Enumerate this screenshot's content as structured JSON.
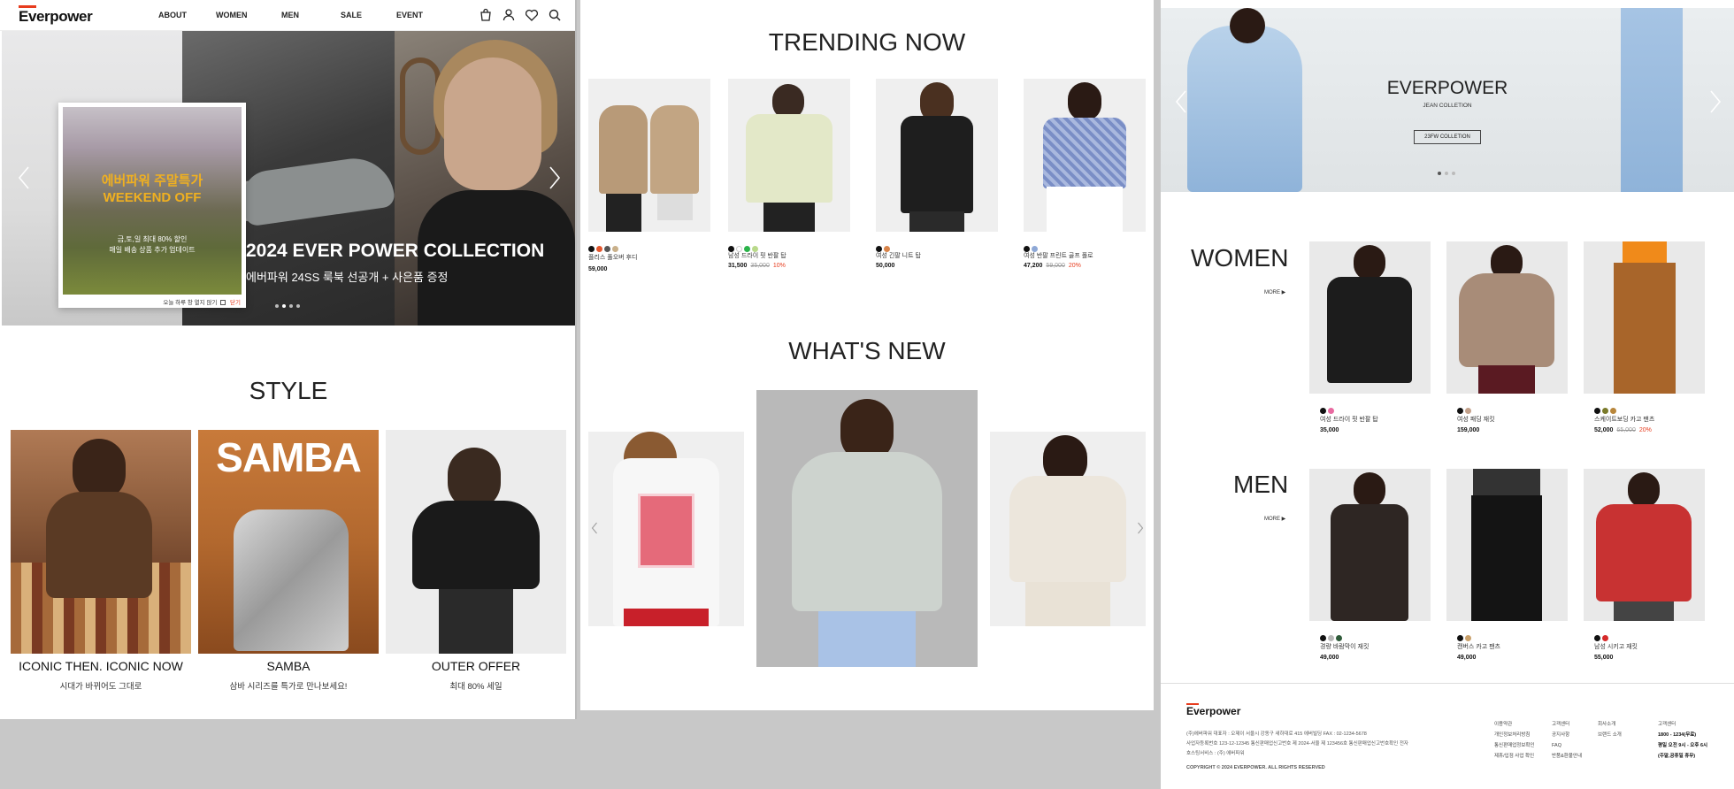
{
  "header": {
    "logo": "Everpower",
    "nav": [
      "ABOUT",
      "WOMEN",
      "MEN",
      "SALE",
      "EVENT"
    ],
    "icons": [
      "bag-icon",
      "user-icon",
      "heart-icon",
      "search-icon"
    ]
  },
  "hero": {
    "popup_title_1": "에버파워 주말특가",
    "popup_title_2": "WEEKEND OFF",
    "popup_sub_1": "금,토,일 최대 80% 할인",
    "popup_sub_2": "매일 배송 상품 추가 업데이트",
    "popup_dismiss": "오늘 하루 창 열지 않기",
    "popup_close": "닫기",
    "title": "2024 EVER POWER COLLECTION",
    "subtitle": "에버파워 24SS 룩북 선공개 + 사은품 증정"
  },
  "style": {
    "title": "STYLE",
    "cards": [
      {
        "caption": "ICONIC THEN. ICONIC NOW",
        "sub": "시대가 바뀌어도 그대로"
      },
      {
        "caption": "SAMBA",
        "sub": "삼바 시리즈를 특가로 만나보세요!",
        "overlay": "SAMBA"
      },
      {
        "caption": "OUTER OFFER",
        "sub": "최대 80% 세일"
      }
    ]
  },
  "trending": {
    "title": "TRENDING NOW",
    "items": [
      {
        "name": "플리스 풀오버 후디",
        "price": "59,000",
        "old": "",
        "disc": "",
        "colors": [
          "#111111",
          "#e4572e",
          "#555555",
          "#c9b08a"
        ]
      },
      {
        "name": "남성 드라이 핏 반팔 탑",
        "price": "31,500",
        "old": "35,000",
        "disc": "10%",
        "colors": [
          "#111111",
          "#ffffff",
          "#2bb34a",
          "#b9d98a"
        ]
      },
      {
        "name": "여성 긴팔 니트 탑",
        "price": "50,000",
        "old": "",
        "disc": "",
        "colors": [
          "#111111",
          "#d8844a"
        ]
      },
      {
        "name": "여성 반팔 프린트 골프 폴로",
        "price": "47,200",
        "old": "59,000",
        "disc": "20%",
        "colors": [
          "#111111",
          "#8ea8d6"
        ]
      }
    ]
  },
  "whats_new": {
    "title": "WHAT'S NEW"
  },
  "jean": {
    "title": "EVERPOWER",
    "sub": "JEAN COLLETION",
    "button": "23FW COLLETION"
  },
  "women": {
    "title": "WOMEN",
    "more": "MORE ▶",
    "items": [
      {
        "name": "여성 드라이 핏 반팔 탑",
        "price": "35,000",
        "old": "",
        "disc": "",
        "colors": [
          "#111111",
          "#e86aa0"
        ]
      },
      {
        "name": "여성 패딩 재킷",
        "price": "159,000",
        "old": "",
        "disc": "",
        "colors": [
          "#111111",
          "#c2a08a"
        ]
      },
      {
        "name": "스케이트보딩 카고 팬츠",
        "price": "52,000",
        "old": "65,000",
        "disc": "20%",
        "colors": [
          "#111111",
          "#7a7a2a",
          "#b8863b"
        ]
      }
    ]
  },
  "men": {
    "title": "MEN",
    "more": "MORE ▶",
    "items": [
      {
        "name": "경량 바람막이 재킷",
        "price": "49,000",
        "old": "",
        "disc": "",
        "colors": [
          "#111111",
          "#b9b9b9",
          "#2f5b3a"
        ]
      },
      {
        "name": "캔버스 카고 팬츠",
        "price": "49,000",
        "old": "",
        "disc": "",
        "colors": [
          "#111111",
          "#c9a06a"
        ]
      },
      {
        "name": "남성 시키고 재킷",
        "price": "55,000",
        "old": "",
        "disc": "",
        "colors": [
          "#111111",
          "#d62a2a"
        ]
      }
    ]
  },
  "footer": {
    "logo": "Everpower",
    "line1": "(주)에버파워   대표자 : 오제이    서울시 강동구 새하대로 415 에버빌딩    FAX : 02-1234-5678",
    "line2": "사업자등록번호 123-12-12345    통신판매업신고번호 제 2024-서울 제 123456호    통신판매업신고번호확인 전자",
    "line3": "호스팅서비스 : (주) 에버파워",
    "copyright": "COPYRIGHT © 2024 EVERPOWER. ALL RIGHTS RESERVED",
    "col1": [
      "이용약관",
      "개인정보처리방침",
      "통신판매업정보확인",
      "제휴/입점 사업 확인"
    ],
    "col2": [
      "고객센터",
      "공지사항",
      "FAQ",
      "반품&환불안내"
    ],
    "col3": [
      "회사소개",
      "브랜드 소개"
    ],
    "col4_title": "고객센터",
    "col4": [
      "1800 - 1234(무료)",
      "평일 오전 9시 - 오후 6시",
      "(주말,공휴일 휴무)"
    ]
  }
}
